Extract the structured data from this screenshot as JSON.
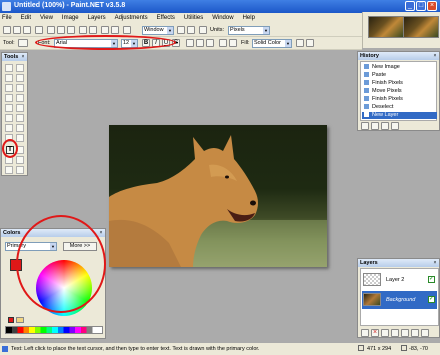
{
  "window": {
    "title": "Untitled (100%) - Paint.NET v3.5.8",
    "buttons": {
      "minimize": "_",
      "maximize": "□",
      "close": "×"
    }
  },
  "menu": [
    "File",
    "Edit",
    "View",
    "Image",
    "Layers",
    "Adjustments",
    "Effects",
    "Utilities",
    "Window",
    "Help"
  ],
  "toolbar": {
    "window_label": "Window",
    "units_label": "Units:",
    "units_value": "Pixels"
  },
  "text_toolbar": {
    "tool_label": "Tool:",
    "font_label": "Font:",
    "font_value": "Arial",
    "size_value": "12",
    "bold": "B",
    "italic": "I",
    "underline": "U",
    "strikeout": "S",
    "fill_label": "Fill:",
    "fill_value": "Solid Color"
  },
  "tools_panel": {
    "title": "Tools"
  },
  "history_panel": {
    "title": "History",
    "items": [
      "New Image",
      "Paste",
      "Finish Pixels",
      "Move Pixels",
      "Finish Pixels",
      "Deselect",
      "New Layer"
    ]
  },
  "layers_panel": {
    "title": "Layers",
    "layers": [
      "Layer 2",
      "Background"
    ]
  },
  "colors_panel": {
    "title": "Colors",
    "mode_value": "Primary",
    "more_label": "More >>"
  },
  "status": {
    "hint": "Text: Left click to place the text cursor, and then type to enter text. Text is drawn with the primary color.",
    "size": "471 x 294",
    "coords": "-83, -70"
  },
  "colors": {
    "primary": "#e01818",
    "annotation": "#e01818",
    "accent": "#1c57c8"
  }
}
